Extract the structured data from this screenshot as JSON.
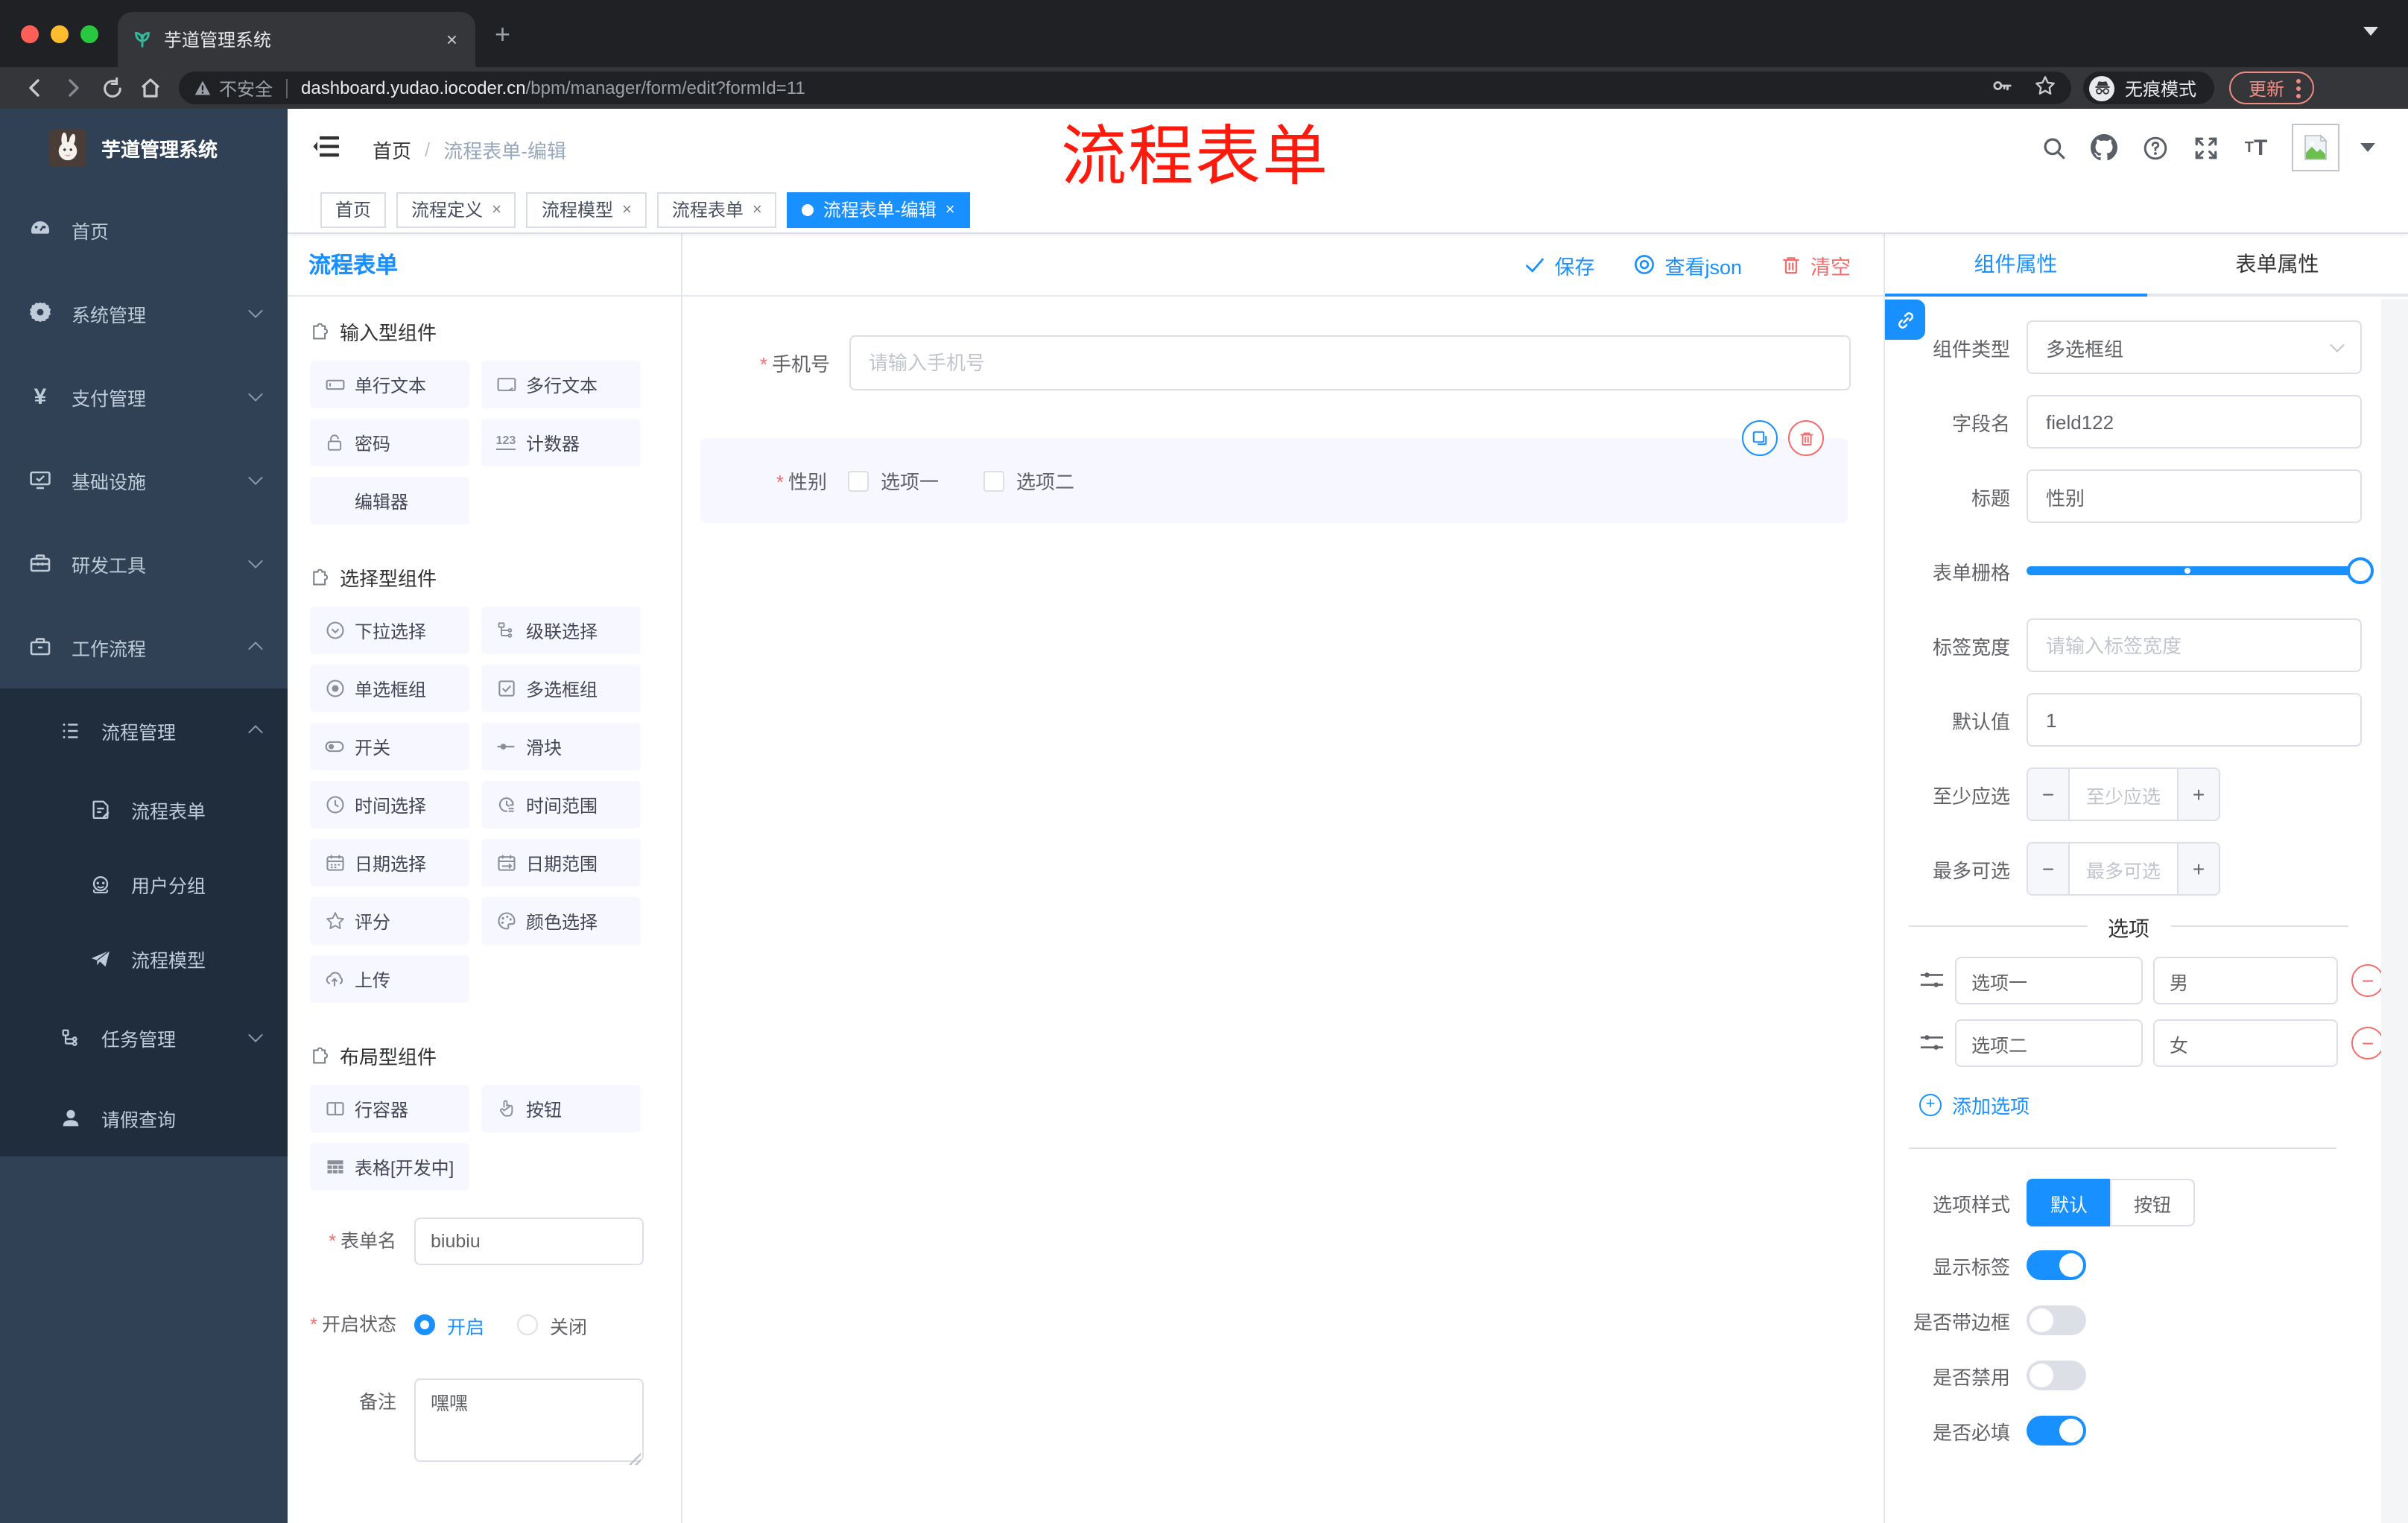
{
  "misc": {
    "required_mark": "*",
    "slash": "/",
    "minus": "−",
    "plus": "+",
    "close": "×",
    "new_tab": "+",
    "tab_close": "×",
    "font_T_big": "T",
    "font_T_small": "T",
    "counter_icon_text": "123"
  },
  "browser": {
    "tab_title": "芋道管理系统",
    "security_label": "不安全",
    "url_host": "dashboard.yudao.iocoder.cn",
    "url_path": "/bpm/manager/form/edit?formId=11",
    "incognito_label": "无痕模式",
    "update_label": "更新"
  },
  "annotation": {
    "text": "流程表单",
    "color": "#fe1b0e"
  },
  "sidebar": {
    "logo_title": "芋道管理系统",
    "menu": [
      {
        "label": "首页",
        "icon": "dashboard-icon"
      },
      {
        "label": "系统管理",
        "icon": "gear-icon"
      },
      {
        "label": "支付管理",
        "icon": "yen-icon"
      },
      {
        "label": "基础设施",
        "icon": "monitor-icon"
      },
      {
        "label": "研发工具",
        "icon": "toolbox-icon"
      },
      {
        "label": "工作流程",
        "icon": "briefcase-icon"
      },
      {
        "label": "流程管理",
        "icon": "list-tree-icon"
      },
      {
        "label": "流程表单",
        "icon": "form-doc-icon"
      },
      {
        "label": "用户分组",
        "icon": "user-group-icon"
      },
      {
        "label": "流程模型",
        "icon": "paper-plane-icon"
      },
      {
        "label": "任务管理",
        "icon": "org-tree-icon"
      },
      {
        "label": "请假查询",
        "icon": "person-icon"
      }
    ]
  },
  "navbar": {
    "breadcrumb_home": "首页",
    "breadcrumb_current": "流程表单-编辑"
  },
  "tags": {
    "tabs": [
      {
        "label": "首页"
      },
      {
        "label": "流程定义"
      },
      {
        "label": "流程模型"
      },
      {
        "label": "流程表单"
      },
      {
        "label": "流程表单-编辑"
      }
    ]
  },
  "builder": {
    "panel_title": "流程表单",
    "toolbar": {
      "save": "保存",
      "view_json": "查看json",
      "clear": "清空"
    },
    "palette": {
      "sections": [
        {
          "title": "输入型组件",
          "items": [
            {
              "label": "单行文本",
              "icon": "input-icon"
            },
            {
              "label": "多行文本",
              "icon": "textarea-icon"
            },
            {
              "label": "密码",
              "icon": "lock-icon"
            },
            {
              "label": "计数器",
              "icon": "counter-icon"
            },
            {
              "label": "编辑器",
              "icon": ""
            }
          ]
        },
        {
          "title": "选择型组件",
          "items": [
            {
              "label": "下拉选择",
              "icon": "select-icon"
            },
            {
              "label": "级联选择",
              "icon": "cascader-icon"
            },
            {
              "label": "单选框组",
              "icon": "radio-icon"
            },
            {
              "label": "多选框组",
              "icon": "checkbox-icon"
            },
            {
              "label": "开关",
              "icon": "switch-icon"
            },
            {
              "label": "滑块",
              "icon": "slider-icon"
            },
            {
              "label": "时间选择",
              "icon": "time-icon"
            },
            {
              "label": "时间范围",
              "icon": "time-range-icon"
            },
            {
              "label": "日期选择",
              "icon": "date-icon"
            },
            {
              "label": "日期范围",
              "icon": "date-range-icon"
            },
            {
              "label": "评分",
              "icon": "star-icon"
            },
            {
              "label": "颜色选择",
              "icon": "palette-icon"
            },
            {
              "label": "上传",
              "icon": "upload-icon"
            }
          ]
        },
        {
          "title": "布局型组件",
          "items": [
            {
              "label": "行容器",
              "icon": "row-icon"
            },
            {
              "label": "按钮",
              "icon": "hand-icon"
            },
            {
              "label": "表格[开发中]",
              "icon": "table-icon"
            }
          ]
        }
      ]
    },
    "form": {
      "name_label": "表单名",
      "name_value": "biubiu",
      "status_label": "开启状态",
      "status_on": "开启",
      "status_off": "关闭",
      "remark_label": "备注",
      "remark_value": "嘿嘿"
    },
    "canvas": {
      "phone_label": "手机号",
      "phone_placeholder": "请输入手机号",
      "gender_label": "性别",
      "gender_option1": "选项一",
      "gender_option2": "选项二"
    },
    "props": {
      "tab_component": "组件属性",
      "tab_form": "表单属性",
      "component_type_label": "组件类型",
      "component_type_value": "多选框组",
      "field_name_label": "字段名",
      "field_name_value": "field122",
      "title_label": "标题",
      "title_value": "性别",
      "grid_label": "表单栅格",
      "label_width_label": "标签宽度",
      "label_width_placeholder": "请输入标签宽度",
      "default_label": "默认值",
      "default_value": "1",
      "min_label": "至少应选",
      "min_placeholder": "至少应选",
      "max_label": "最多可选",
      "max_placeholder": "最多可选",
      "options_divider": "选项",
      "options": [
        {
          "label": "选项一",
          "value": "男"
        },
        {
          "label": "选项二",
          "value": "女"
        }
      ],
      "add_option": "添加选项",
      "option_style_label": "选项样式",
      "option_style_default": "默认",
      "option_style_button": "按钮",
      "show_label_label": "显示标签",
      "show_label_on": true,
      "border_label": "是否带边框",
      "border_on": false,
      "disabled_label": "是否禁用",
      "disabled_on": false,
      "required_label": "是否必填",
      "required_on": true,
      "accent_color": "#1890ff",
      "danger_color": "#f56c6c"
    }
  }
}
